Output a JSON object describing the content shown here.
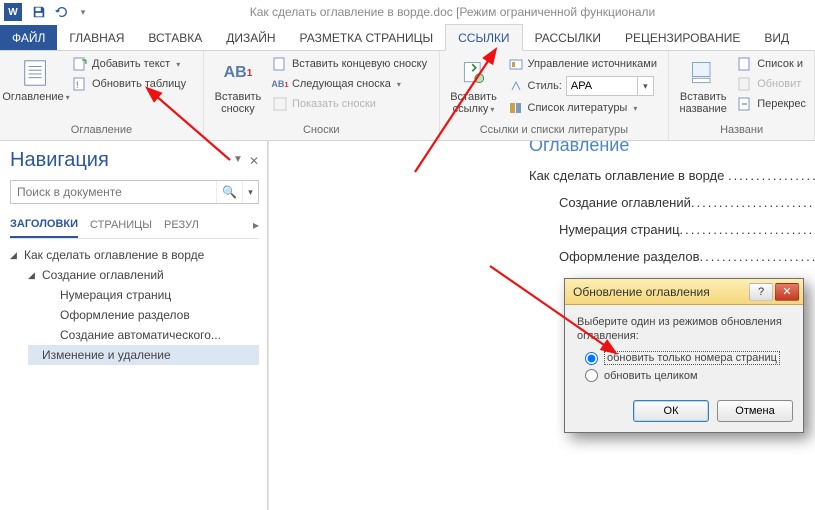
{
  "titlebar": {
    "doc_title": "Как сделать оглавление в ворде.doc [Режим ограниченной функционали"
  },
  "tabs": {
    "file": "ФАЙЛ",
    "home": "ГЛАВНАЯ",
    "insert": "ВСТАВКА",
    "design": "ДИЗАЙН",
    "layout": "РАЗМЕТКА СТРАНИЦЫ",
    "references": "ССЫЛКИ",
    "mailings": "РАССЫЛКИ",
    "review": "РЕЦЕНЗИРОВАНИЕ",
    "view": "ВИД"
  },
  "ribbon": {
    "toc": {
      "big": "Оглавление",
      "add_text": "Добавить текст",
      "update": "Обновить таблицу",
      "group": "Оглавление"
    },
    "footnotes": {
      "ab": "AB",
      "big": "Вставить\nсноску",
      "insert_end": "Вставить концевую сноску",
      "next": "Следующая сноска",
      "show": "Показать сноски",
      "group": "Сноски"
    },
    "citations": {
      "big": "Вставить\nссылку",
      "manage": "Управление источниками",
      "style_label": "Стиль:",
      "style_value": "APA",
      "biblio": "Список литературы",
      "group": "Ссылки и списки литературы"
    },
    "captions": {
      "big": "Вставить\nназвание",
      "list": "Список и",
      "update": "Обновит",
      "cross": "Перекрес",
      "group": "Названи"
    }
  },
  "nav": {
    "title": "Навигация",
    "search_placeholder": "Поиск в документе",
    "tabs": {
      "headings": "ЗАГОЛОВКИ",
      "pages": "СТРАНИЦЫ",
      "results": "РЕЗУЛ"
    },
    "tree": {
      "root": "Как сделать оглавление в ворде",
      "n1": "Создание оглавлений",
      "n1a": "Нумерация страниц",
      "n1b": "Оформление разделов",
      "n1c": "Создание автоматического...",
      "n2": "Изменение и удаление"
    }
  },
  "page": {
    "toc_title": "Оглавление",
    "l1": "Как сделать оглавление в ворде",
    "l2": "Создание оглавлений",
    "l3": "Нумерация страниц",
    "l4": "Оформление разделов"
  },
  "dialog": {
    "title": "Обновление оглавления",
    "prompt": "Выберите один из режимов обновления оглавления:",
    "opt1": "обновить только номера страниц",
    "opt2": "обновить целиком",
    "ok": "ОК",
    "cancel": "Отмена"
  }
}
